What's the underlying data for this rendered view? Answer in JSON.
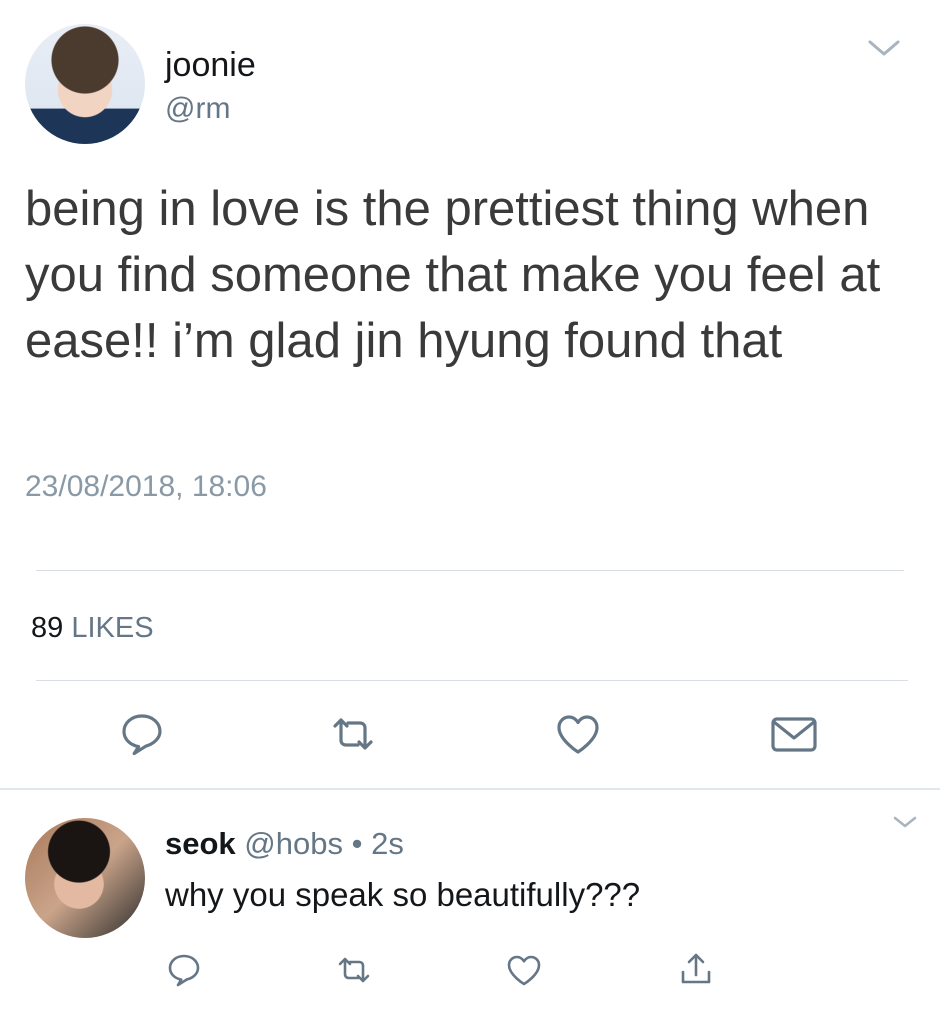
{
  "main_tweet": {
    "display_name": "joonie",
    "handle": "@rm",
    "text": "being in love is the prettiest thing when you find someone that make you feel at ease!! i’m glad jin hyung found that",
    "timestamp": "23/08/2018, 18:06",
    "likes_count": "89",
    "likes_label": "LIKES",
    "actions": [
      "reply-icon",
      "retweet-icon",
      "like-icon",
      "direct-message-icon"
    ]
  },
  "reply": {
    "display_name": "seok",
    "handle": "@hobs",
    "separator": " • ",
    "time_ago": "2s",
    "text": "why you speak so beautifully???",
    "actions": [
      "reply-icon",
      "retweet-icon",
      "like-icon",
      "share-icon"
    ]
  },
  "colors": {
    "text": "#14171a",
    "secondary": "#657786",
    "icon": "#657786",
    "divider": "#d8dee3"
  }
}
